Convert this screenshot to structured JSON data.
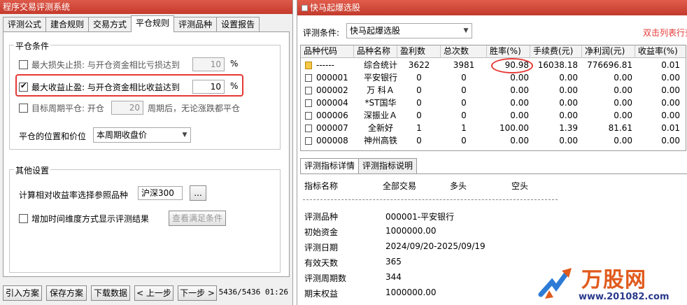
{
  "left": {
    "title": "程序交易评测系统",
    "tabs": [
      "评测公式",
      "建合规则",
      "交易方式",
      "平仓规则",
      "评测品种",
      "设置报告"
    ],
    "active_tab": "平仓规则",
    "close_group": {
      "label": "平仓条件",
      "max_loss": {
        "label": "最大损失止损: 与开仓资金相比亏损达到",
        "value": "10",
        "unit": "%",
        "checked": false
      },
      "max_gain": {
        "label": "最大收益止盈: 与开仓资金相比收益达到",
        "value": "10",
        "unit": "%",
        "checked": true
      },
      "target_period": {
        "label": "目标周期平仓: 开仓",
        "value": "20",
        "suffix": "周期后，无论涨跌都平仓",
        "checked": false
      },
      "position_price": {
        "label": "平仓的位置和价位",
        "selected": "本周期收盘价"
      }
    },
    "other_group": {
      "label": "其他设置",
      "ref": {
        "label": "计算相对收益率选择参照品种",
        "value": "沪深300",
        "browse": "..."
      },
      "timedim": {
        "label": "增加时间维度方式显示评测结果",
        "button": "查看满足条件",
        "checked": false
      }
    },
    "buttons": [
      "引入方案",
      "保存方案",
      "下载数据",
      "< 上一步",
      "下一步 >"
    ],
    "status": "5436/5436 01:26"
  },
  "right": {
    "title": "快马起爆选股",
    "cond_label": "评测条件:",
    "cond_value": "快马起爆选股",
    "hint": "双击列表行查",
    "headers": [
      "品种代码",
      "品种名称",
      "盈利数",
      "总次数",
      "胜率(%)",
      "手续费(元)",
      "净利润(元)",
      "收益率(%)"
    ],
    "rows": [
      [
        "------",
        "综合统计",
        "3622",
        "3981",
        "90.98",
        "16038.18",
        "776696.81",
        "0.01"
      ],
      [
        "000001",
        "平安银行",
        "0",
        "0",
        "0.00",
        "0.00",
        "0.00",
        "0.00"
      ],
      [
        "000002",
        "万 科Ａ",
        "0",
        "0",
        "0.00",
        "0.00",
        "0.00",
        "0.00"
      ],
      [
        "000004",
        "*ST国华",
        "0",
        "0",
        "0.00",
        "0.00",
        "0.00",
        "0.00"
      ],
      [
        "000006",
        "深振业Ａ",
        "0",
        "0",
        "0.00",
        "0.00",
        "0.00",
        "0.00"
      ],
      [
        "000007",
        "全新好",
        "1",
        "1",
        "100.00",
        "1.39",
        "81.61",
        "0.01"
      ],
      [
        "000008",
        "神州高铁",
        "0",
        "0",
        "0.00",
        "0.00",
        "0.00",
        "0.00"
      ]
    ],
    "detail_tabs": [
      "评测指标详情",
      "评测指标说明"
    ],
    "detail_headers": [
      "指标名称",
      "全部交易",
      "多头",
      "空头"
    ],
    "detail_rows": [
      [
        "评测品种",
        "000001-平安银行"
      ],
      [
        "初始资金",
        "1000000.00"
      ],
      [
        "评测日期",
        "2024/09/20-2025/09/19"
      ],
      [
        "有效天数",
        "365"
      ],
      [
        "评测周期数",
        "344"
      ],
      [
        "期末权益",
        "1000000.00"
      ]
    ],
    "watermark": {
      "name": "万股网",
      "url": "www.201082.com"
    }
  }
}
